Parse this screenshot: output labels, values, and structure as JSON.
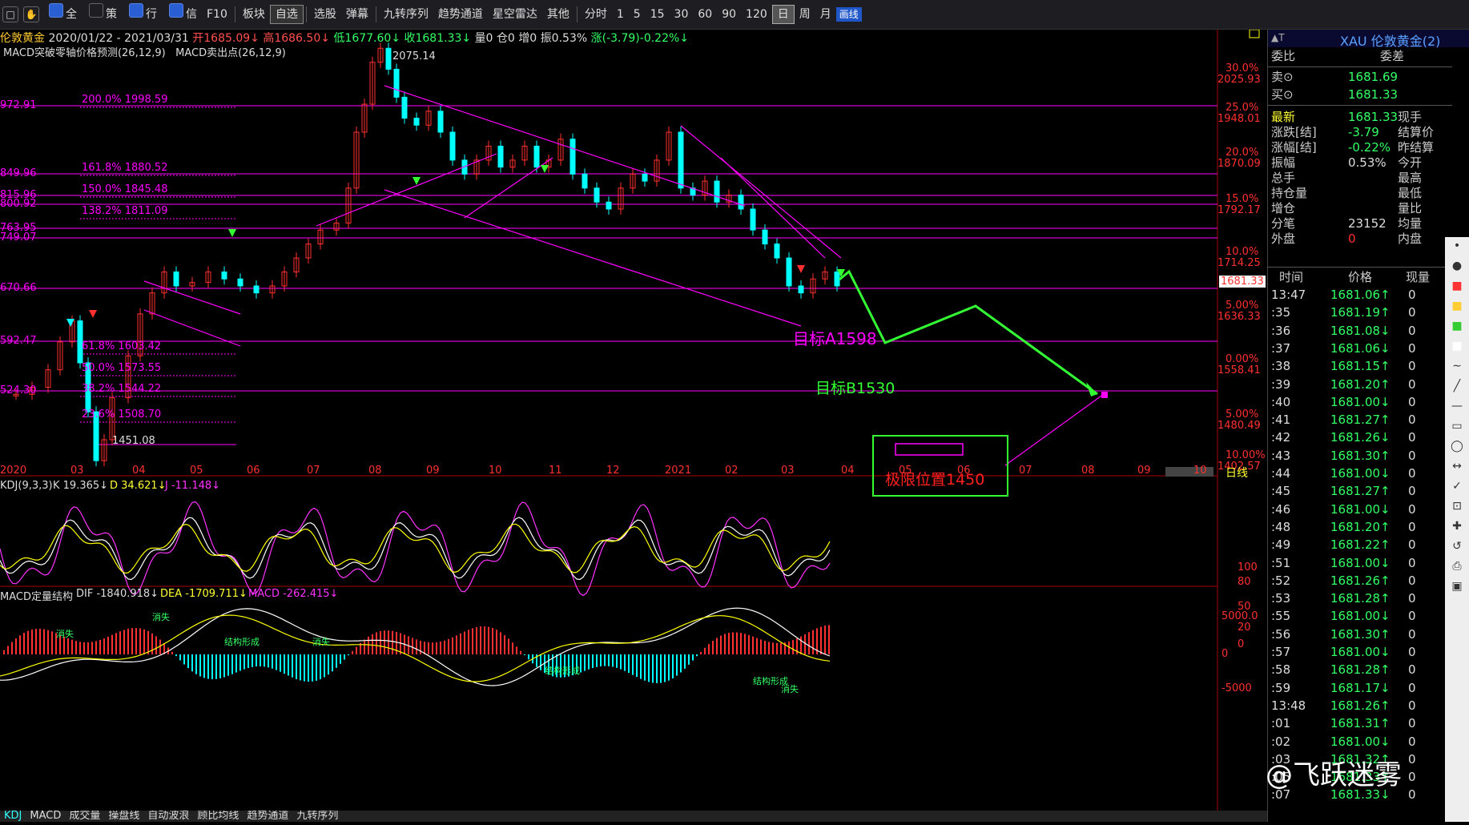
{
  "toolbar": {
    "items": [
      "全",
      "策",
      "行",
      "信",
      "F10",
      "板块",
      "自选",
      "选股",
      "弹幕",
      "九转序列",
      "趋势通道",
      "星空雷达",
      "其他",
      "分时",
      "1",
      "5",
      "15",
      "30",
      "60",
      "90",
      "120",
      "日",
      "周",
      "月",
      "画线"
    ]
  },
  "header": {
    "symbol": "伦敦黄金",
    "range": "2020/01/22 - 2021/03/31",
    "open": "开1685.09↓",
    "high": "高1686.50↓",
    "low": "低1677.60↓",
    "close": "收1681.33↓",
    "oi": "量0",
    "pos": "仓0",
    "inc": "增0",
    "amp": "振0.53%",
    "chg": "涨(-3.79)-0.22%↓",
    "ind1": "MACD突破零轴价格预测(26,12,9)",
    "ind2": "MACD卖出点(26,12,9)"
  },
  "fib": [
    {
      "label": "200.0% 1998.59"
    },
    {
      "label": "161.8% 1880.52"
    },
    {
      "label": "150.0% 1845.48"
    },
    {
      "label": "138.2% 1811.09"
    },
    {
      "label": "61.8% 1603.42"
    },
    {
      "label": "50.0% 1573.55"
    },
    {
      "label": "38.2% 1544.22"
    },
    {
      "label": "23.6% 1508.70"
    }
  ],
  "left_levels": [
    "972.91",
    "849.96",
    "815.96",
    "800.92",
    "763.95",
    "749.07",
    "670.66",
    "592.47",
    "524.30"
  ],
  "peak_label": "2075.14",
  "trough_label": "1451.08",
  "right_axis": [
    {
      "pct": "30.0%",
      "price": "2025.93"
    },
    {
      "pct": "25.0%",
      "price": "1948.01"
    },
    {
      "pct": "20.0%",
      "price": "1870.09"
    },
    {
      "pct": "15.0%",
      "price": "1792.17"
    },
    {
      "pct": "10.0%",
      "price": "1714.25"
    },
    {
      "pct": "5.00%",
      "price": "1636.33"
    },
    {
      "pct": "0.00%",
      "price": "1558.41"
    },
    {
      "pct": "5.00%",
      "price": "1480.49"
    },
    {
      "pct": "10.00%",
      "price": "1402.57"
    }
  ],
  "current_price": "1681.33",
  "annotations": {
    "target_a": "目标A1598",
    "target_b": "目标B1530",
    "limit": "极限位置1450"
  },
  "months": [
    "2020",
    "03",
    "04",
    "05",
    "06",
    "07",
    "08",
    "09",
    "10",
    "11",
    "12",
    "2021",
    "02",
    "03",
    "04",
    "05",
    "06",
    "07",
    "08",
    "09",
    "10"
  ],
  "period_label": "日线",
  "kdj": {
    "title": "KDJ(9,3,3)",
    "k": "K 19.365↓",
    "d": "D 34.621↓",
    "j": "J -11.148↓",
    "ticks": [
      "100",
      "80",
      "50",
      "20",
      "0"
    ]
  },
  "macd": {
    "title": "MACD定量结构",
    "dif": "DIF -1840.918↓",
    "dea": "DEA -1709.711↓",
    "macd": "MACD -262.415↓",
    "ticks": [
      "5000.0",
      "0",
      "-5000"
    ],
    "marks": [
      "消失",
      "消失",
      "结构形成",
      "消失",
      "结构形成",
      "结构形成",
      "消失"
    ]
  },
  "bottom_tabs": [
    "KDJ",
    "MACD",
    "成交量",
    "操盘线",
    "自动波浪",
    "顾比均线",
    "趋势通道",
    "九转序列"
  ],
  "panel": {
    "title": "XAU 伦敦黄金(2)",
    "weibi": "委比",
    "weicha": "委差",
    "sell_label": "卖⊙",
    "sell": "1681.69",
    "buy_label": "买⊙",
    "buy": "1681.33",
    "rows": [
      {
        "l": "最新",
        "v": "1681.33",
        "r": "现手"
      },
      {
        "l": "涨跌[结]",
        "v": "-3.79",
        "r": "结算价"
      },
      {
        "l": "涨幅[结]",
        "v": "-0.22%",
        "r": "昨结算"
      },
      {
        "l": "振幅",
        "v": "0.53%",
        "r": "今开"
      },
      {
        "l": "总手",
        "v": "",
        "r": "最高"
      },
      {
        "l": "持仓量",
        "v": "",
        "r": "最低"
      },
      {
        "l": "增仓",
        "v": "",
        "r": "量比"
      },
      {
        "l": "分笔",
        "v": "23152",
        "r": "均量"
      },
      {
        "l": "外盘",
        "v": "0",
        "r": "内盘"
      }
    ],
    "tick_headers": [
      "时间",
      "价格",
      "现量"
    ],
    "ticks": [
      {
        "t": "13:47",
        "p": "1681.06↑",
        "q": "0"
      },
      {
        "t": ":35",
        "p": "1681.19↑",
        "q": "0"
      },
      {
        "t": ":36",
        "p": "1681.08↓",
        "q": "0"
      },
      {
        "t": ":37",
        "p": "1681.06↓",
        "q": "0"
      },
      {
        "t": ":38",
        "p": "1681.15↑",
        "q": "0"
      },
      {
        "t": ":39",
        "p": "1681.20↑",
        "q": "0"
      },
      {
        "t": ":40",
        "p": "1681.00↓",
        "q": "0"
      },
      {
        "t": ":41",
        "p": "1681.27↑",
        "q": "0"
      },
      {
        "t": ":42",
        "p": "1681.26↓",
        "q": "0"
      },
      {
        "t": ":43",
        "p": "1681.30↑",
        "q": "0"
      },
      {
        "t": ":44",
        "p": "1681.00↓",
        "q": "0"
      },
      {
        "t": ":45",
        "p": "1681.27↑",
        "q": "0"
      },
      {
        "t": ":46",
        "p": "1681.00↓",
        "q": "0"
      },
      {
        "t": ":48",
        "p": "1681.20↑",
        "q": "0"
      },
      {
        "t": ":49",
        "p": "1681.22↑",
        "q": "0"
      },
      {
        "t": ":51",
        "p": "1681.00↓",
        "q": "0"
      },
      {
        "t": ":52",
        "p": "1681.26↑",
        "q": "0"
      },
      {
        "t": ":53",
        "p": "1681.28↑",
        "q": "0"
      },
      {
        "t": ":55",
        "p": "1681.00↓",
        "q": "0"
      },
      {
        "t": ":56",
        "p": "1681.30↑",
        "q": "0"
      },
      {
        "t": ":57",
        "p": "1681.00↓",
        "q": "0"
      },
      {
        "t": ":58",
        "p": "1681.28↑",
        "q": "0"
      },
      {
        "t": ":59",
        "p": "1681.17↓",
        "q": "0"
      },
      {
        "t": "13:48",
        "p": "1681.26↑",
        "q": "0"
      },
      {
        "t": ":01",
        "p": "1681.31↑",
        "q": "0"
      },
      {
        "t": ":02",
        "p": "1681.00↓",
        "q": "0"
      },
      {
        "t": ":03",
        "p": "1681.32↑",
        "q": "0"
      },
      {
        "t": ":05",
        "p": "1681.33↑",
        "q": "0"
      },
      {
        "t": ":07",
        "p": "1681.33↓",
        "q": "0"
      }
    ]
  },
  "watermark": "@飞跃迷雾",
  "colors": {
    "up": "#ff3030",
    "down": "#00ffff",
    "grid": "#ff00ff",
    "green": "#33ff33",
    "yellow": "#ffff00"
  }
}
